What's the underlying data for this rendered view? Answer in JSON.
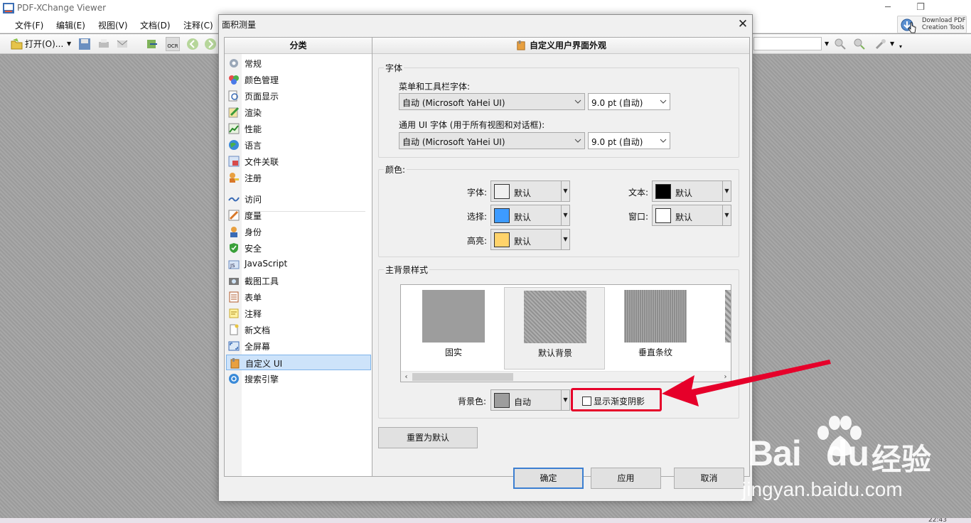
{
  "app": {
    "title": "PDF-XChange Viewer",
    "minimize": "─",
    "restore": "❐",
    "download_line1": "Download PDF",
    "download_line2": "Creation Tools"
  },
  "menu": [
    "文件(F)",
    "编辑(E)",
    "视图(V)",
    "文档(D)",
    "注释(C)"
  ],
  "toolbar": {
    "open_label": "打开(O)...",
    "ocr_label": "OCR"
  },
  "dialog": {
    "title": "面积测量",
    "close": "✕",
    "categories_header": "分类",
    "categories": [
      "常规",
      "颜色管理",
      "页面显示",
      "渲染",
      "性能",
      "语言",
      "文件关联",
      "注册",
      "访问",
      "度量",
      "身份",
      "安全",
      "JavaScript",
      "截图工具",
      "表单",
      "注释",
      "新文档",
      "全屏幕",
      "自定义 UI",
      "搜索引擎"
    ],
    "selected_category": "自定义 UI",
    "content_header": "自定义用户界面外观",
    "font_group": {
      "title": "字体",
      "menu_font_label": "菜单和工具栏字体:",
      "menu_font_value": "自动 (Microsoft YaHei UI)",
      "menu_size_value": "9.0 pt (自动)",
      "ui_font_label": "通用 UI 字体 (用于所有视图和对话框):",
      "ui_font_value": "自动 (Microsoft YaHei UI)",
      "ui_size_value": "9.0 pt (自动)"
    },
    "color_group": {
      "title": "颜色:",
      "font_label": "字体:",
      "font_value": "默认",
      "font_color": "#f0f0f0",
      "text_label": "文本:",
      "text_value": "默认",
      "text_color": "#000000",
      "select_label": "选择:",
      "select_value": "默认",
      "select_color": "#3d9bff",
      "window_label": "窗口:",
      "window_value": "默认",
      "window_color": "#ffffff",
      "highlight_label": "高亮:",
      "highlight_value": "默认",
      "highlight_color": "#ffd36a"
    },
    "bg_group": {
      "title": "主背景样式",
      "styles": [
        "固实",
        "默认背景",
        "垂直条纹"
      ],
      "selected_style": "默认背景",
      "bg_color_label": "背景色:",
      "bg_color_value": "自动",
      "bg_color": "#9d9d9d",
      "gradient_label": "显示渐变阴影",
      "gradient_checked": false
    },
    "reset_label": "重置为默认",
    "ok_label": "确定",
    "apply_label": "应用",
    "cancel_label": "取消"
  },
  "watermark": {
    "brand": "Bai",
    "brand2": "du",
    "cn": "经验",
    "url": "jingyan.baidu.com"
  },
  "taskbar_time": "22:43",
  "colors": {
    "accent": "#3c7fd1",
    "annotation_red": "#e6002a",
    "selection_bg": "#cde3fa"
  }
}
